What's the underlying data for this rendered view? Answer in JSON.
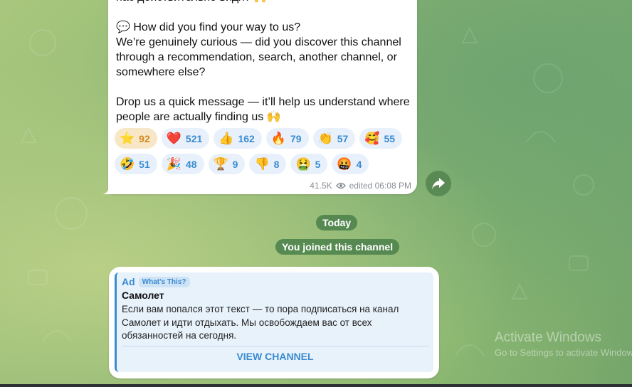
{
  "post": {
    "text": "нас действительно видят 🙌\n\n💬 How did you find your way to us?\nWe’re genuinely curious — did you discover this channel through a recommendation, search, another channel, or somewhere else?\n\nDrop us a quick message — it’ll help us understand where people are actually finding us 🙌",
    "reactions": [
      {
        "emoji": "⭐",
        "count": "92",
        "active": true
      },
      {
        "emoji": "❤️",
        "count": "521"
      },
      {
        "emoji": "👍",
        "count": "162"
      },
      {
        "emoji": "🔥",
        "count": "79"
      },
      {
        "emoji": "👏",
        "count": "57"
      },
      {
        "emoji": "🥰",
        "count": "55"
      },
      {
        "emoji": "🤣",
        "count": "51"
      },
      {
        "emoji": "🎉",
        "count": "48"
      },
      {
        "emoji": "🏆",
        "count": "9"
      },
      {
        "emoji": "👎",
        "count": "8"
      },
      {
        "emoji": "🤮",
        "count": "5"
      },
      {
        "emoji": "🤬",
        "count": "4"
      }
    ],
    "views": "41.5K",
    "edited": "edited 06:08 PM"
  },
  "date_separator": "Today",
  "service_message": "You joined this channel",
  "ad": {
    "label": "Ad",
    "whats_this": "What's This?",
    "title": "Самолет",
    "body": "Если вам попался этот текст — то пора подписаться на канал\nСамолет и идти отдыхать. Мы освобождаем вас от всех\nобязанностей на сегодня.",
    "button": "VIEW CHANNEL"
  },
  "watermark": {
    "line1": "Activate Windows",
    "line2": "Go to Settings to activate Windows."
  },
  "icons": {
    "share": "share-icon",
    "views": "eye-icon"
  },
  "colors": {
    "accent": "#3a8bd1",
    "service_pill": "#4a804a",
    "active_reaction": "#f7e7c6"
  }
}
